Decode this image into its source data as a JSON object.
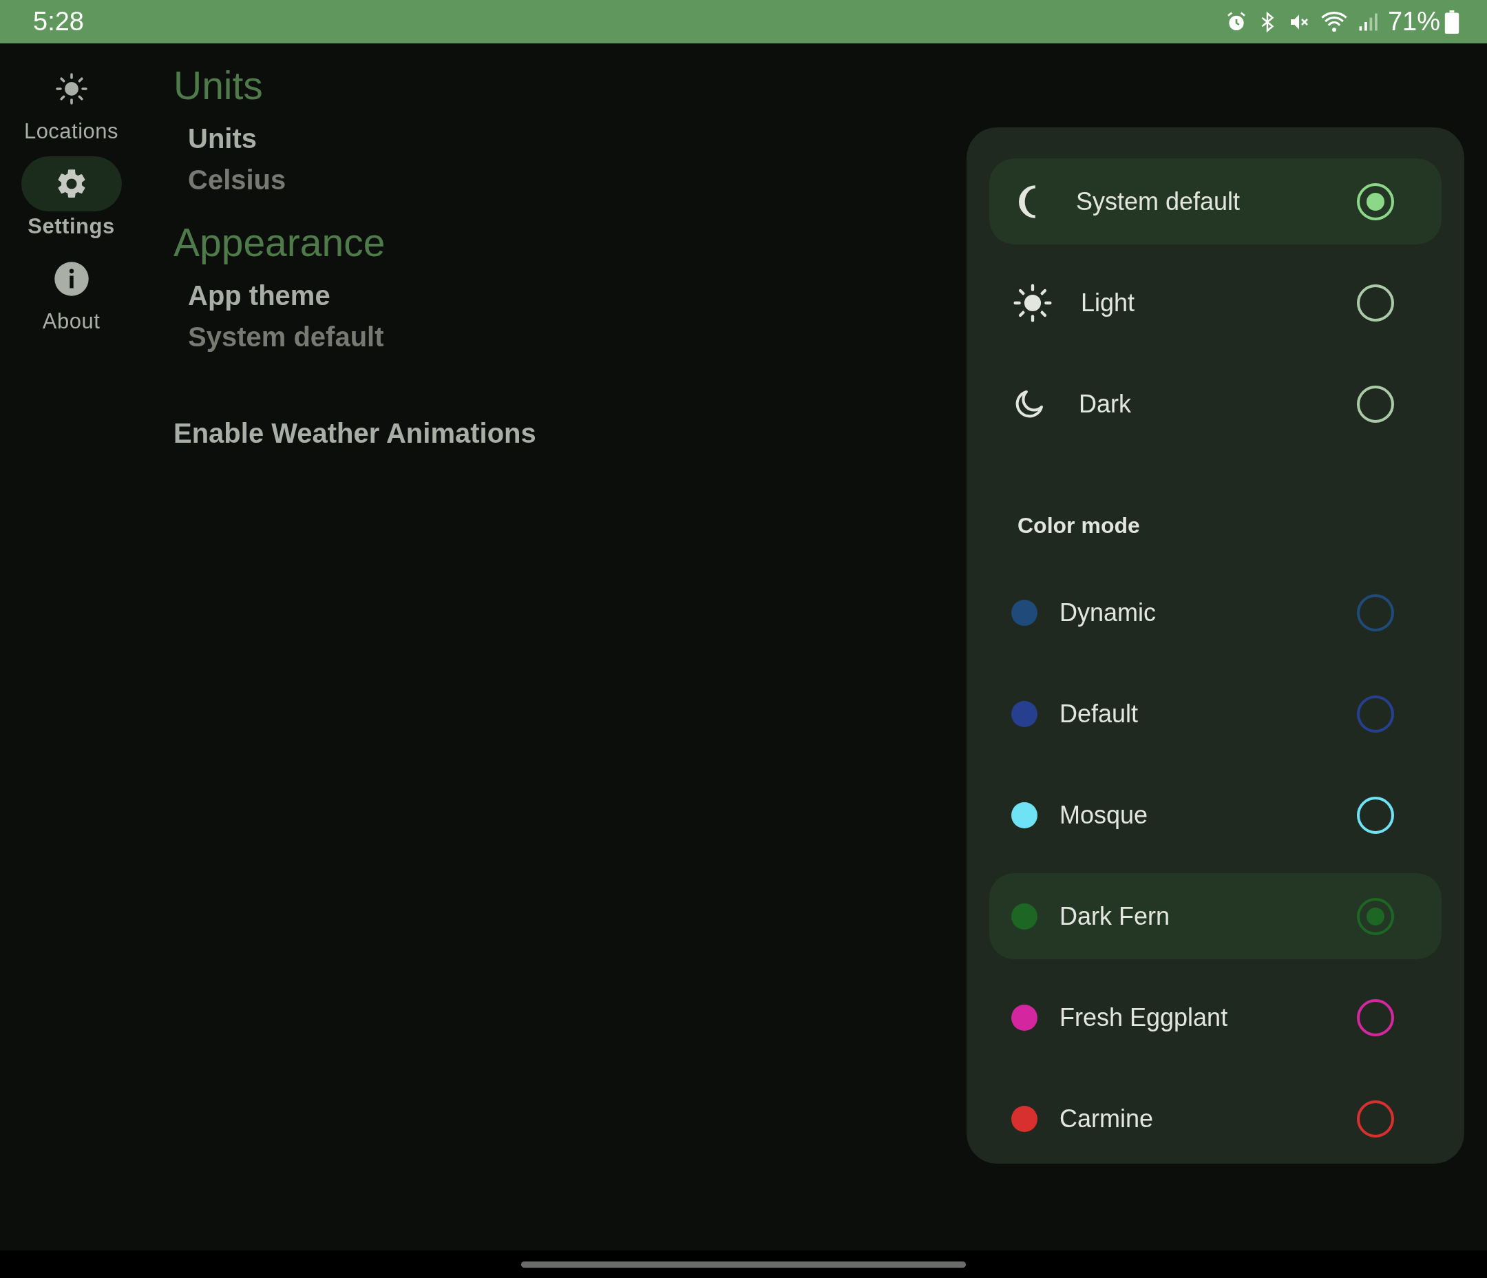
{
  "status_bar": {
    "time": "5:28",
    "battery": "71%"
  },
  "nav_rail": {
    "items": [
      {
        "label": "Locations",
        "kind": "sun",
        "selected": false
      },
      {
        "label": "Settings",
        "kind": "gear",
        "selected": true
      },
      {
        "label": "About",
        "kind": "info",
        "selected": false
      }
    ]
  },
  "settings": {
    "sections": [
      {
        "title": "Units",
        "items": [
          {
            "title": "Units",
            "value": "Celsius"
          }
        ]
      },
      {
        "title": "Appearance",
        "items": [
          {
            "title": "App theme",
            "value": "System default"
          }
        ]
      }
    ],
    "toggle_item": "Enable Weather Animations"
  },
  "theme_menu": {
    "themes": [
      {
        "label": "System default",
        "kind": "system",
        "selected": true
      },
      {
        "label": "Light",
        "kind": "light",
        "selected": false
      },
      {
        "label": "Dark",
        "kind": "dark",
        "selected": false
      }
    ],
    "color_mode_title": "Color mode",
    "colors": [
      {
        "label": "Dynamic",
        "color": "#1f4a7a",
        "selected": false
      },
      {
        "label": "Default",
        "color": "#26408f",
        "selected": false
      },
      {
        "label": "Mosque",
        "color": "#6fe3f5",
        "selected": false
      },
      {
        "label": "Dark Fern",
        "color": "#1e6624",
        "selected": true
      },
      {
        "label": "Fresh Eggplant",
        "color": "#d4279f",
        "selected": false
      },
      {
        "label": "Carmine",
        "color": "#d8302f",
        "selected": false
      }
    ]
  }
}
